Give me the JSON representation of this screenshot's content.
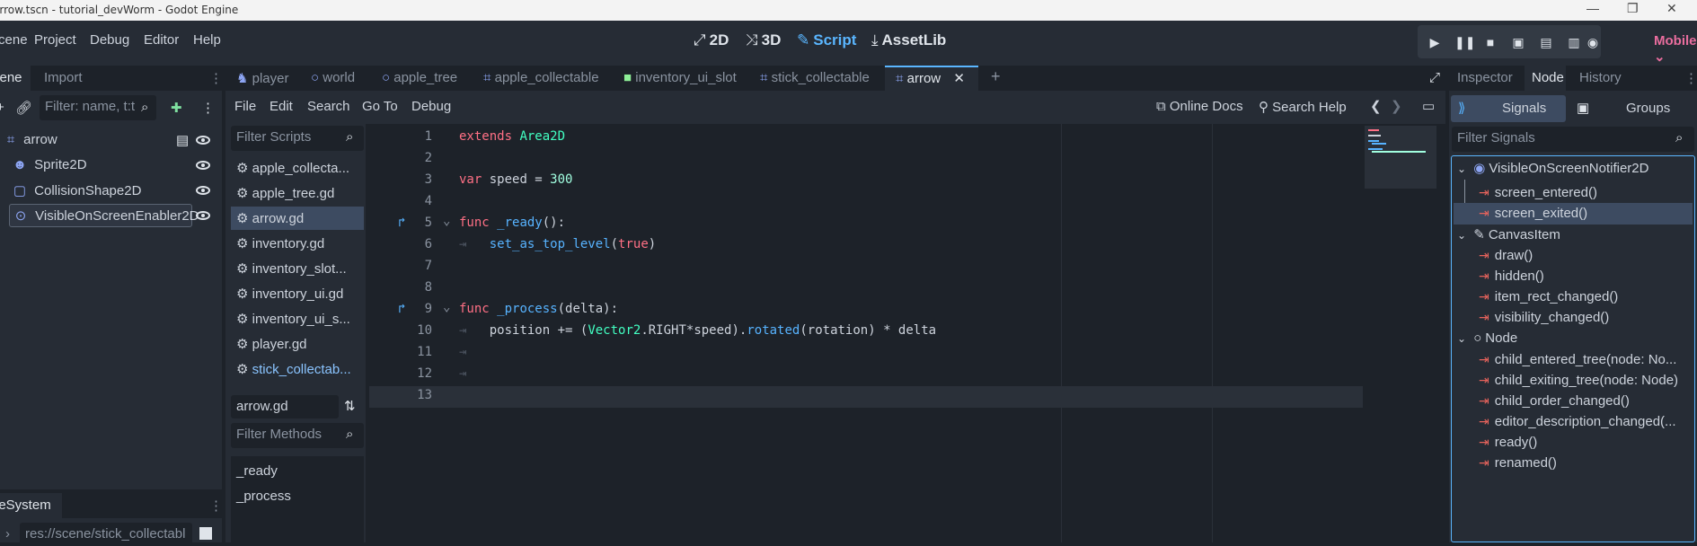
{
  "window": {
    "title": "arrow.tscn - tutorial_devWorm - Godot Engine"
  },
  "menubar": [
    "Scene",
    "Project",
    "Debug",
    "Editor",
    "Help"
  ],
  "workspaces": [
    {
      "label": "2D",
      "glyph": "⤢"
    },
    {
      "label": "3D",
      "glyph": "⤨"
    },
    {
      "label": "Script",
      "glyph": "✎"
    },
    {
      "label": "AssetLib",
      "glyph": "⤓"
    }
  ],
  "renderer": "Mobile",
  "scene_dock": {
    "tabs": [
      "Scene",
      "Import"
    ],
    "filter_placeholder": "Filter: name, t:t",
    "root": "arrow",
    "children": [
      "Sprite2D",
      "CollisionShape2D",
      "VisibleOnScreenEnabler2D"
    ]
  },
  "filesystem": {
    "tab": "FileSystem",
    "path": "res://scene/stick_collectabl"
  },
  "editor_tabs": [
    "player",
    "world",
    "apple_tree",
    "apple_collectable",
    "inventory_ui_slot",
    "stick_collectable",
    "arrow"
  ],
  "script_menu": [
    "File",
    "Edit",
    "Search",
    "Go To",
    "Debug"
  ],
  "script_toolbar": {
    "online_docs": "Online Docs",
    "search_help": "Search Help"
  },
  "scripts_panel": {
    "filter_placeholder": "Filter Scripts",
    "files": [
      "apple_collecta...",
      "apple_tree.gd",
      "arrow.gd",
      "inventory.gd",
      "inventory_slot...",
      "inventory_ui.gd",
      "inventory_ui_s...",
      "player.gd",
      "stick_collectab..."
    ],
    "current": "arrow.gd",
    "methods_placeholder": "Filter Methods",
    "methods": [
      "_ready",
      "_process"
    ]
  },
  "code": {
    "line_numbers": [
      "1",
      "2",
      "3",
      "4",
      "5",
      "6",
      "7",
      "8",
      "9",
      "10",
      "11",
      "12",
      "13"
    ],
    "l1": {
      "kw": "extends",
      "ty": "Area2D"
    },
    "l3": {
      "kw": "var",
      "rest": "speed = ",
      "num": "300"
    },
    "l5": {
      "kw": "func",
      "fn": "_ready",
      "rest": "():"
    },
    "l6": {
      "fn": "set_as_top_level",
      "open": "(",
      "kw": "true",
      "close": ")"
    },
    "l9": {
      "kw": "func",
      "fn": "_process",
      "rest": "(delta):"
    },
    "l10": {
      "a": "position += (",
      "ty": "Vector2",
      "b": ".RIGHT*speed).",
      "fn": "rotated",
      "c": "(rotation) * delta"
    }
  },
  "inspector": {
    "tabs": [
      "Inspector",
      "Node",
      "History"
    ],
    "subtabs": [
      "Signals",
      "Groups"
    ],
    "filter_placeholder": "Filter Signals",
    "sections": [
      {
        "name": "VisibleOnScreenNotifier2D",
        "signals": [
          "screen_entered()",
          "screen_exited()"
        ]
      },
      {
        "name": "CanvasItem",
        "signals": [
          "draw()",
          "hidden()",
          "item_rect_changed()",
          "visibility_changed()"
        ]
      },
      {
        "name": "Node",
        "signals": [
          "child_entered_tree(node: No...",
          "child_exiting_tree(node: Node)",
          "child_order_changed()",
          "editor_description_changed(...",
          "ready()",
          "renamed()"
        ]
      }
    ]
  }
}
